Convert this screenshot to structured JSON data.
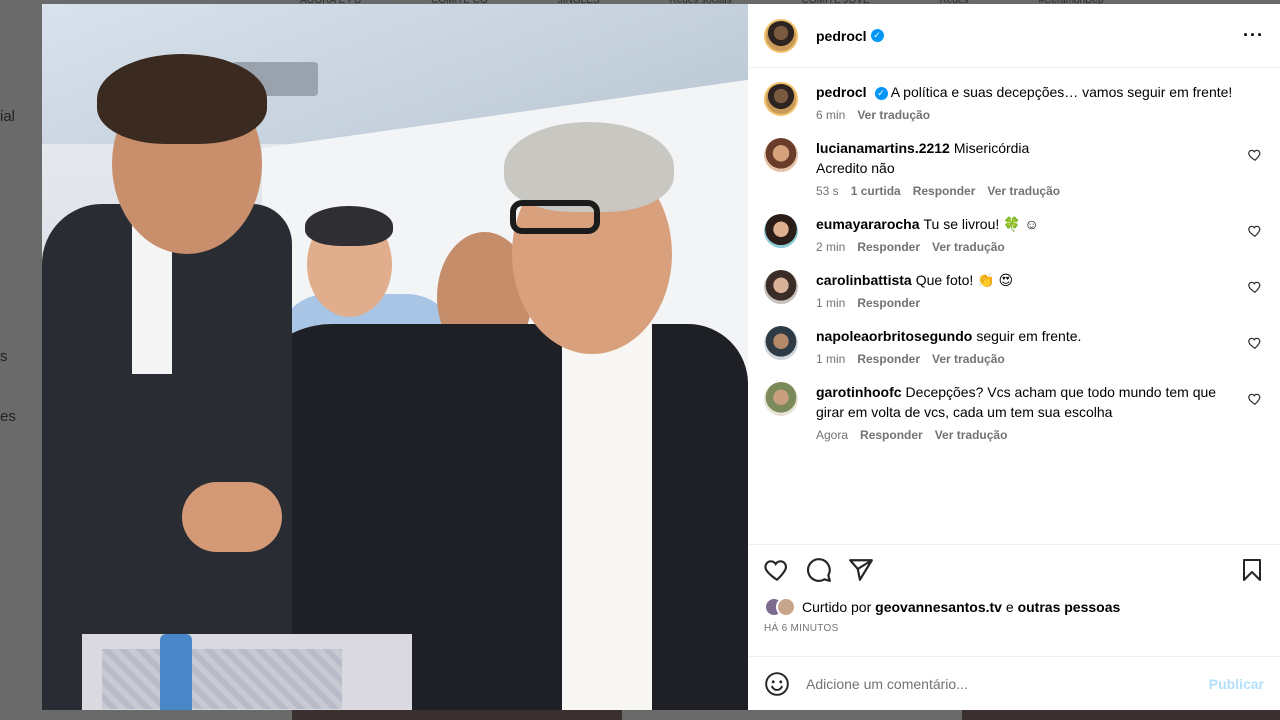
{
  "background": {
    "top_nav": [
      "AGORA E PB",
      "COMITÊ CG",
      "JINGLES",
      "Redes sociais",
      "COMITÊ JOVE",
      "Redes",
      "#CeramonDep"
    ],
    "side_labels": [
      "ial",
      "s",
      "es"
    ]
  },
  "post": {
    "author": "pedrocl",
    "verified": true,
    "caption": "A política e suas decepções… vamos seguir em frente!",
    "caption_time": "6 min",
    "translate_label": "Ver tradução"
  },
  "comments": [
    {
      "username": "lucianamartins.2212",
      "text": "Misericórdia",
      "text2": "Acredito não",
      "time": "53 s",
      "likes": "1 curtida",
      "reply": "Responder",
      "translate": "Ver tradução"
    },
    {
      "username": "eumayararocha",
      "text": "Tu se livrou! 🍀 ☺",
      "time": "2 min",
      "reply": "Responder",
      "translate": "Ver tradução"
    },
    {
      "username": "carolinbattista",
      "text": "Que foto! 👏 😍",
      "time": "1 min",
      "reply": "Responder"
    },
    {
      "username": "napoleaorbritosegundo",
      "text": "seguir em frente.",
      "time": "1 min",
      "reply": "Responder",
      "translate": "Ver tradução"
    },
    {
      "username": "garotinhoofc",
      "text": "Decepções? Vcs acham que todo mundo tem que girar em volta de vcs, cada um tem sua escolha",
      "time": "Agora",
      "reply": "Responder",
      "translate": "Ver tradução"
    }
  ],
  "likes": {
    "prefix": "Curtido por",
    "user": "geovannesantos.tv",
    "conj": "e",
    "others": "outras pessoas",
    "when": "HÁ 6 MINUTOS"
  },
  "add_comment": {
    "placeholder": "Adicione um comentário...",
    "publish": "Publicar"
  },
  "colors": {
    "verified": "#0095f6",
    "publish_disabled": "#b2dffc",
    "muted": "#737373"
  },
  "icons": [
    "more-options-icon",
    "heart-icon",
    "comment-icon",
    "share-icon",
    "bookmark-icon",
    "emoji-icon"
  ]
}
